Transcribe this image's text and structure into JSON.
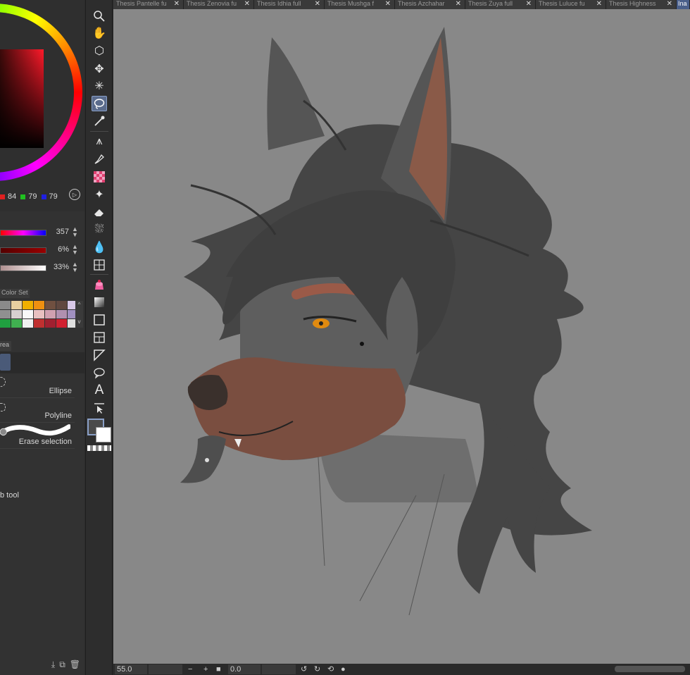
{
  "color_panel": {
    "rgb": {
      "r": "84",
      "g": "79",
      "b": "79"
    },
    "colors": {
      "r": "#e02020",
      "g": "#20c020",
      "b": "#2020e0"
    }
  },
  "hsv_sliders": [
    {
      "name": "hue",
      "value": "357"
    },
    {
      "name": "saturation",
      "value": "6%"
    },
    {
      "name": "value",
      "value": "33%"
    }
  ],
  "color_set": {
    "tab_label": "Color Set",
    "swatches": [
      "#8a8a8a",
      "#e8d0a0",
      "#f0b000",
      "#f09010",
      "#705040",
      "#604840",
      "#d8c8e8",
      "#909090",
      "#d8d0d0",
      "#f8f8f8",
      "#e8c0c0",
      "#d0a0b0",
      "#b090b0",
      "#a090c0",
      "#20a040",
      "#40b050",
      "#f0f0f0",
      "#c03030",
      "#a02030",
      "#d02030",
      "#e0e0e0"
    ]
  },
  "sub_tool": {
    "tab_label": "rea",
    "items": [
      {
        "label": "Ellipse"
      },
      {
        "label": "Polyline"
      },
      {
        "label": "Erase selection"
      }
    ],
    "tool_text": "b tool"
  },
  "toolbar": {
    "tools": [
      "zoom",
      "hand",
      "object",
      "move",
      "auto-select",
      "lasso-selection",
      "eyedropper",
      "pen",
      "brush",
      "pattern-fill",
      "sparkle",
      "eraser",
      "blend",
      "fill-drops",
      "correct-line",
      "cake",
      "gradient",
      "rectangle",
      "frame",
      "triangle",
      "balloon",
      "text",
      "operation"
    ]
  },
  "tabs": [
    {
      "label": "Thesis Pantelle fu"
    },
    {
      "label": "Thesis Zenovia fu"
    },
    {
      "label": "Thesis Idhia full"
    },
    {
      "label": "Thesis Mushga f"
    },
    {
      "label": "Thesis Azchahar"
    },
    {
      "label": "Thesis Zuya full"
    },
    {
      "label": "Thesis Luluce fu"
    },
    {
      "label": "Thesis Highness"
    }
  ],
  "active_tab": {
    "label": "Ina"
  },
  "status": {
    "zoom": "55.0",
    "rotation": "0.0"
  },
  "colors": {
    "main_color": "#4a4a4a",
    "sub_color": "#ffffff",
    "canvas_bg": "#888888",
    "accent": "#5a6b8c"
  }
}
